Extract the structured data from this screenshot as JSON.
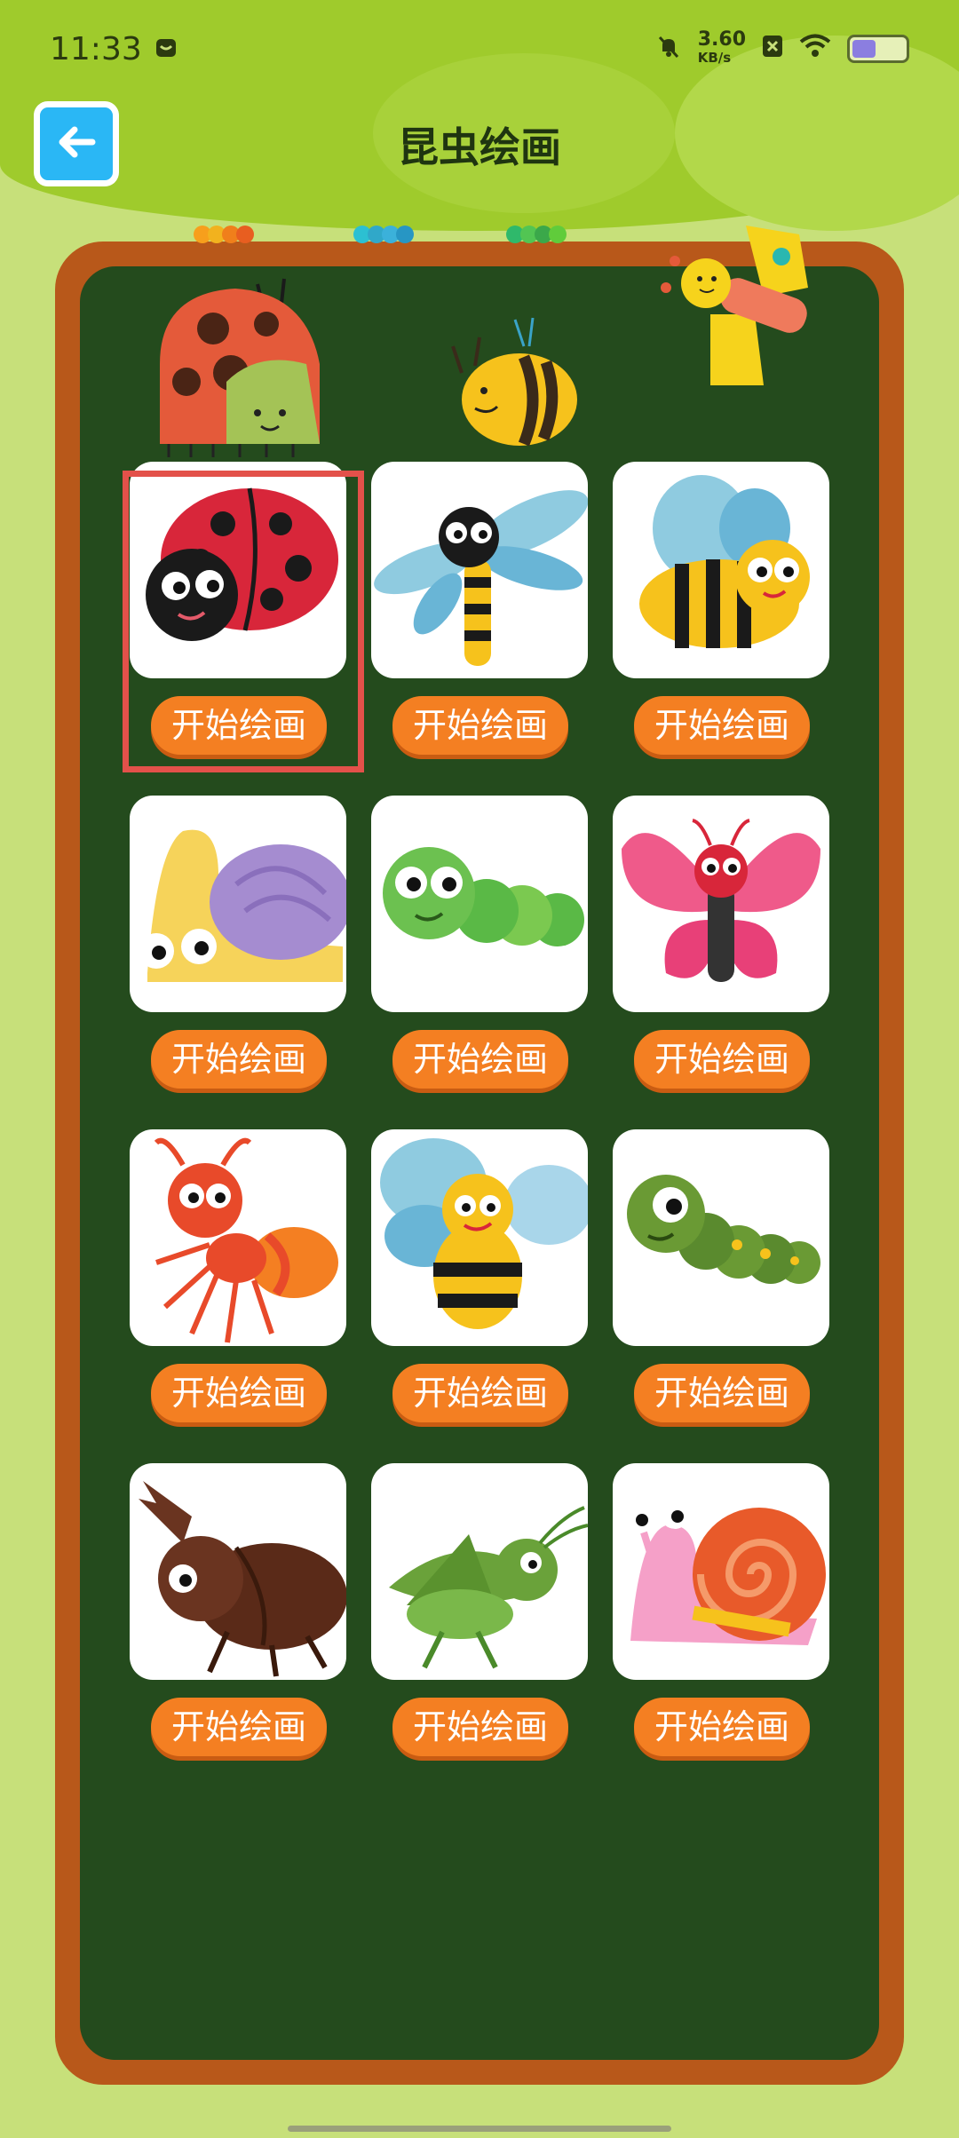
{
  "status_bar": {
    "time": "11:33",
    "speed_value": "3.60",
    "speed_unit": "KB/s",
    "icons": [
      "message-icon",
      "mute-icon",
      "close-box-icon",
      "wifi-icon",
      "battery-icon"
    ]
  },
  "header": {
    "title": "昆虫绘画",
    "back_icon": "arrow-left-icon"
  },
  "insects": [
    {
      "name": "ladybug",
      "button_label": "开始绘画"
    },
    {
      "name": "dragonfly",
      "button_label": "开始绘画"
    },
    {
      "name": "bee",
      "button_label": "开始绘画"
    },
    {
      "name": "snail-yellow",
      "button_label": "开始绘画"
    },
    {
      "name": "caterpillar-green",
      "button_label": "开始绘画"
    },
    {
      "name": "butterfly-pink",
      "button_label": "开始绘画"
    },
    {
      "name": "ant-red",
      "button_label": "开始绘画"
    },
    {
      "name": "bee-flying",
      "button_label": "开始绘画"
    },
    {
      "name": "caterpillar-dark-green",
      "button_label": "开始绘画"
    },
    {
      "name": "beetle",
      "button_label": "开始绘画"
    },
    {
      "name": "grasshopper",
      "button_label": "开始绘画"
    },
    {
      "name": "snail-pink",
      "button_label": "开始绘画"
    }
  ],
  "colors": {
    "background": "#c7e07a",
    "board": "#244b1d",
    "frame": "#b8581a",
    "button": "#f47f22",
    "back_button": "#2ab7f5",
    "highlight": "#e3514a"
  }
}
